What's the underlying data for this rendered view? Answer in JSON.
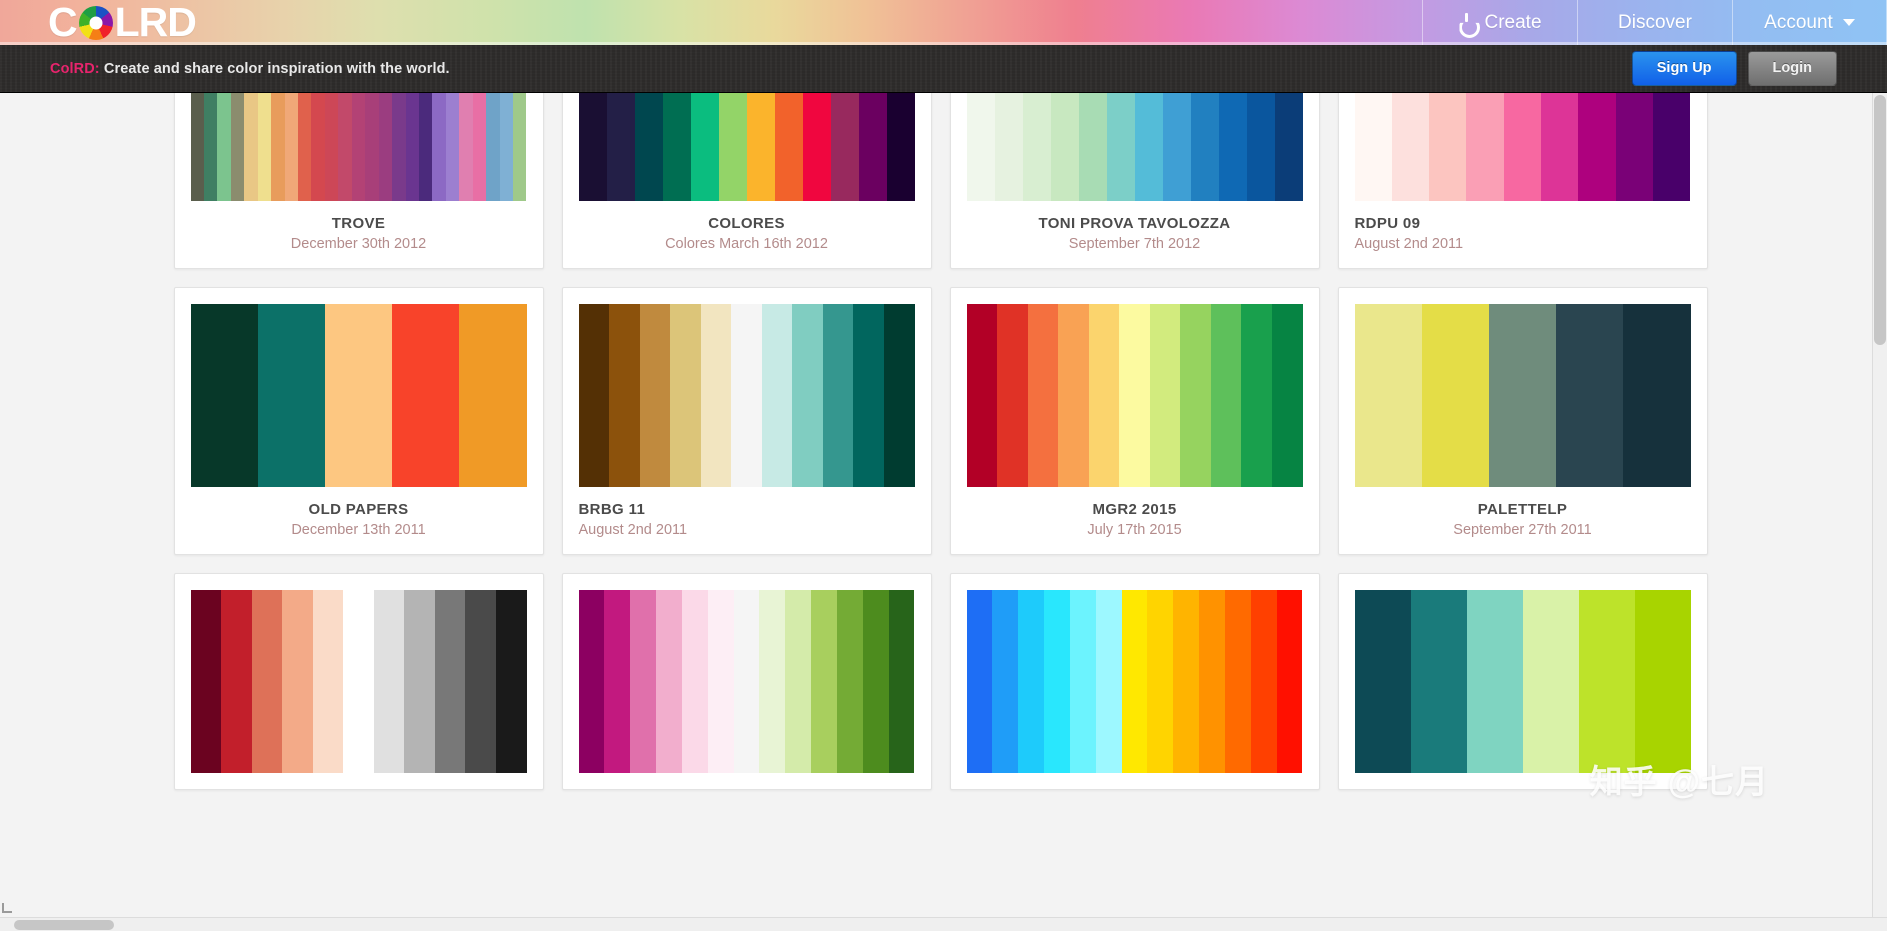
{
  "header": {
    "logo_text_left": "C",
    "logo_text_right": "LRD",
    "logo_icon": "color-wheel-icon",
    "nav": [
      {
        "label": "Create",
        "icon": "power-icon",
        "has_caret": false
      },
      {
        "label": "Discover",
        "icon": null,
        "has_caret": false
      },
      {
        "label": "Account",
        "icon": null,
        "has_caret": true
      }
    ]
  },
  "promo": {
    "brand": "ColRD:",
    "tagline": "Create and share color inspiration with the world.",
    "signup_label": "Sign Up",
    "login_label": "Login"
  },
  "colors": {
    "accent_pink": "#e8246d",
    "signup_blue": "#1160e8",
    "date_text": "#b38b8b",
    "title_text": "#4b4b4b",
    "page_bg": "#f3f3f3",
    "promo_bg": "#2e2c2b"
  },
  "watermark": "知乎 @七月",
  "columns": [
    {
      "cards": [
        {
          "name": "TROVE",
          "date": "December 30th 2012",
          "align": "center",
          "partial_top": true,
          "swatches": [
            "#5a5e4d",
            "#3f7f63",
            "#7cc48e",
            "#8b8c6e",
            "#e9c785",
            "#efdf8e",
            "#e89c5c",
            "#f0a878",
            "#e0614c",
            "#d4484f",
            "#cd4757",
            "#c2496a",
            "#b34275",
            "#a83f79",
            "#9b3d80",
            "#7a3a8b",
            "#6a3590",
            "#4b2a7c",
            "#8c69c4",
            "#9c7fd0",
            "#e07fb0",
            "#e86fa5",
            "#6fa3c8",
            "#7fb0d4",
            "#9fc98a"
          ]
        },
        {
          "name": "OLD PAPERS",
          "date": "December 13th 2011",
          "align": "center",
          "partial_top": false,
          "swatches": [
            "#073829",
            "#0c7168",
            "#fdc781",
            "#f8432a",
            "#f09a26"
          ]
        },
        {
          "name": "",
          "date": "",
          "align": "center",
          "partial_top": false,
          "swatches": [
            "#6b0320",
            "#c21f2b",
            "#de7158",
            "#f3aa88",
            "#fadbc8",
            "#ffffff",
            "#e0e0e0",
            "#b4b4b4",
            "#787878",
            "#4a4a4a",
            "#1a1a1a"
          ]
        }
      ]
    },
    {
      "cards": [
        {
          "name": "COLORES",
          "date": "Colores March 16th 2012",
          "align": "center",
          "partial_top": true,
          "swatches": [
            "#1a0f33",
            "#231f47",
            "#00474f",
            "#006e52",
            "#0bbd7f",
            "#93d468",
            "#fbb42c",
            "#f2622b",
            "#f0063f",
            "#98295e",
            "#6b0060",
            "#1a0030"
          ]
        },
        {
          "name": "BRBG 11",
          "date": "August 2nd 2011",
          "align": "left",
          "partial_top": false,
          "swatches": [
            "#543005",
            "#8c520c",
            "#c08a3e",
            "#dcc579",
            "#f2e5c0",
            "#f5f5f5",
            "#c7eae5",
            "#80cdc1",
            "#35978f",
            "#01665e",
            "#003c30"
          ]
        },
        {
          "name": "",
          "date": "",
          "align": "center",
          "partial_top": false,
          "swatches": [
            "#8c0061",
            "#c2197f",
            "#e070ab",
            "#f2aecd",
            "#fbd9e8",
            "#fdeef5",
            "#f5f5f5",
            "#e8f4d5",
            "#d4ebaa",
            "#a8cf5e",
            "#74ab35",
            "#4d8c1e",
            "#27641a"
          ]
        }
      ]
    },
    {
      "cards": [
        {
          "name": "TONI PROVA TAVOLOZZA",
          "date": "September 7th 2012",
          "align": "center",
          "partial_top": true,
          "swatches": [
            "#f0f7ec",
            "#e6f2e0",
            "#d8eed1",
            "#c8e8c0",
            "#a8dcb4",
            "#7ccfc8",
            "#54bcd8",
            "#3f9fd4",
            "#2180c0",
            "#0f69b4",
            "#0a569e",
            "#0b3d78"
          ]
        },
        {
          "name": "MGR2 2015",
          "date": "July 17th 2015",
          "align": "center",
          "partial_top": false,
          "swatches": [
            "#b20026",
            "#e03226",
            "#f4703f",
            "#f9a254",
            "#fbd46d",
            "#fcfaa0",
            "#d2eb7e",
            "#96d35f",
            "#5ec05b",
            "#19a04d",
            "#068443"
          ]
        },
        {
          "name": "",
          "date": "",
          "align": "center",
          "partial_top": false,
          "swatches": [
            "#1e6ef5",
            "#1f9df8",
            "#1ecbfb",
            "#29e7fd",
            "#6cf3fe",
            "#9df8ff",
            "#ffe800",
            "#ffd400",
            "#ffb400",
            "#ff9200",
            "#ff6a00",
            "#ff4000",
            "#ff1000"
          ]
        }
      ]
    },
    {
      "cards": [
        {
          "name": "RDPU 09",
          "date": "August 2nd 2011",
          "align": "left",
          "partial_top": true,
          "swatches": [
            "#fff7f3",
            "#fde0dd",
            "#fcc5c0",
            "#fa9fb5",
            "#f768a1",
            "#dd3497",
            "#ae017e",
            "#7a0177",
            "#49006a"
          ]
        },
        {
          "name": "PALETTELP",
          "date": "September 27th 2011",
          "align": "center",
          "partial_top": false,
          "swatches": [
            "#eae78c",
            "#e4dd47",
            "#6f8c7c",
            "#2a4550",
            "#16313c"
          ]
        },
        {
          "name": "",
          "date": "",
          "align": "center",
          "partial_top": false,
          "swatches": [
            "#0d4a55",
            "#1a7b7b",
            "#7fd4c1",
            "#d9f2a8",
            "#bde32a",
            "#a8d400"
          ]
        }
      ]
    }
  ]
}
